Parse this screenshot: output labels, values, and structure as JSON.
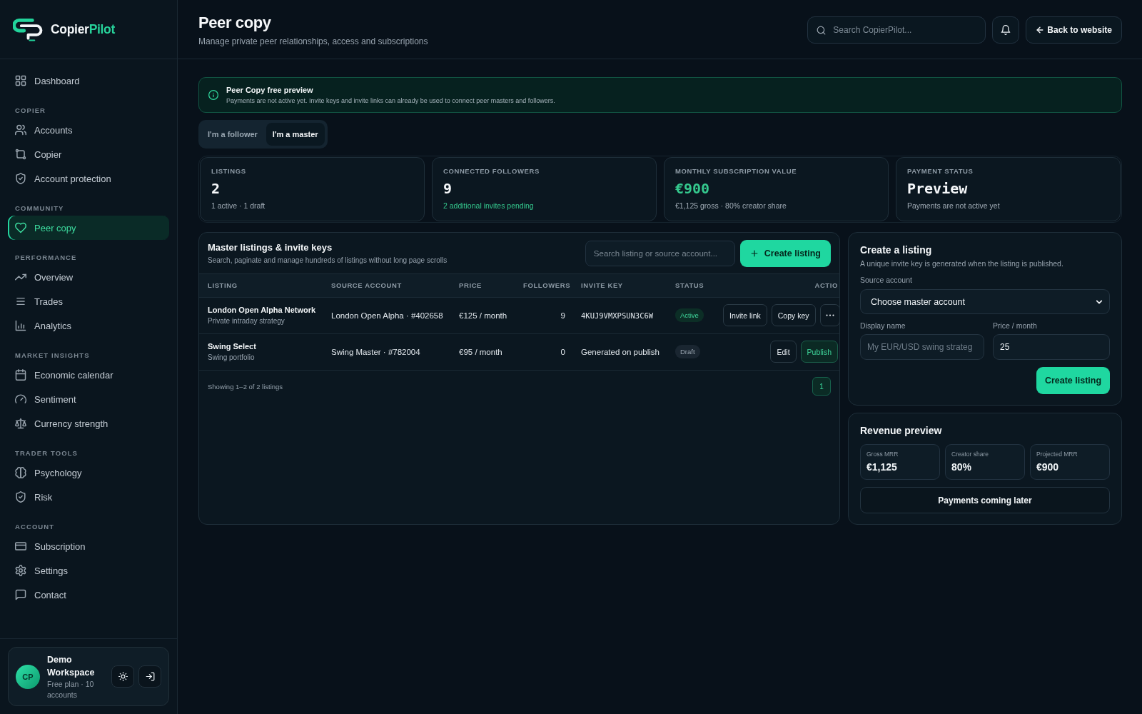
{
  "sidebar": {
    "brand": {
      "name": "Copier",
      "accent": "Pilot"
    },
    "nav": [
      {
        "items": [
          {
            "label": "Dashboard",
            "selected": false
          }
        ]
      },
      {
        "heading": "COPIER",
        "items": [
          {
            "label": "Accounts",
            "selected": false
          },
          {
            "label": "Copier",
            "selected": false
          },
          {
            "label": "Account protection",
            "selected": false
          }
        ]
      },
      {
        "heading": "COMMUNITY",
        "items": [
          {
            "label": "Peer copy",
            "selected": true
          }
        ]
      },
      {
        "heading": "PERFORMANCE",
        "items": [
          {
            "label": "Overview",
            "selected": false
          },
          {
            "label": "Trades",
            "selected": false
          },
          {
            "label": "Analytics",
            "selected": false
          }
        ]
      },
      {
        "heading": "MARKET INSIGHTS",
        "items": [
          {
            "label": "Economic calendar",
            "selected": false
          },
          {
            "label": "Sentiment",
            "selected": false
          },
          {
            "label": "Currency strength",
            "selected": false
          }
        ]
      },
      {
        "heading": "TRADER TOOLS",
        "items": [
          {
            "label": "Psychology",
            "selected": false
          },
          {
            "label": "Risk",
            "selected": false
          }
        ]
      },
      {
        "heading": "ACCOUNT",
        "items": [
          {
            "label": "Subscription",
            "selected": false
          },
          {
            "label": "Settings",
            "selected": false
          },
          {
            "label": "Contact",
            "selected": false
          }
        ]
      }
    ],
    "user": {
      "initials": "CP",
      "name": "Demo Workspace",
      "plan": "Free plan · 10 accounts"
    }
  },
  "header": {
    "title": "Peer copy",
    "subtitle": "Manage private peer relationships, access and subscriptions",
    "search": {
      "placeholder": "Search CopierPilot..."
    },
    "back_button": "Back to website"
  },
  "notice": {
    "title": "Peer Copy free preview",
    "text": "Payments are not active yet. Invite keys and invite links can already be used to connect peer masters and followers."
  },
  "role_tabs": [
    {
      "label": "I'm a follower",
      "selected": false
    },
    {
      "label": "I'm a master",
      "selected": true
    }
  ],
  "stats": [
    {
      "label": "LISTINGS",
      "value": "2",
      "value_accent": false,
      "note": "1 active · 1 draft",
      "note_accent": false
    },
    {
      "label": "CONNECTED FOLLOWERS",
      "value": "9",
      "value_accent": false,
      "note": "2 additional invites pending",
      "note_accent": true
    },
    {
      "label": "MONTHLY SUBSCRIPTION VALUE",
      "value": "€900",
      "value_accent": true,
      "note": "€1,125 gross · 80% creator share",
      "note_accent": false
    },
    {
      "label": "PAYMENT STATUS",
      "value": "Preview",
      "value_accent": false,
      "note": "Payments are not active yet",
      "note_accent": false
    }
  ],
  "listings": {
    "title": "Master listings & invite keys",
    "subtitle": "Search, paginate and manage hundreds of listings without long page scrolls",
    "search": {
      "placeholder": "Search listing or source account..."
    },
    "create_button": "Create listing",
    "columns": [
      "LISTING",
      "SOURCE ACCOUNT",
      "PRICE",
      "FOLLOWERS",
      "INVITE KEY",
      "STATUS",
      "ACTIO"
    ],
    "rows": [
      {
        "listing": {
          "name": "London Open Alpha Network",
          "description": "Private intraday strategy"
        },
        "source_account": "London Open Alpha · #402658",
        "price": "€125 / month",
        "followers": "9",
        "invite_key": {
          "text": "4KUJ9VMXPSUN3C6W",
          "kind": "key"
        },
        "status": {
          "label": "Active",
          "kind": "active"
        },
        "actions": [
          {
            "label": "Invite link",
            "kind": "outline"
          },
          {
            "label": "Copy key",
            "kind": "outline"
          },
          {
            "kind": "more"
          }
        ]
      },
      {
        "listing": {
          "name": "Swing Select",
          "description": "Swing portfolio"
        },
        "source_account": "Swing Master · #782004",
        "price": "€95 / month",
        "followers": "0",
        "invite_key": {
          "text": "Generated on publish",
          "kind": "pending"
        },
        "status": {
          "label": "Draft",
          "kind": "draft"
        },
        "actions": [
          {
            "label": "Edit",
            "kind": "outline"
          },
          {
            "label": "Publish",
            "kind": "accent"
          }
        ]
      }
    ],
    "summary": "Showing 1–2 of 2 listings",
    "pages": [
      {
        "label": "1",
        "selected": true
      }
    ]
  },
  "create_listing": {
    "title": "Create a listing",
    "subtitle": "A unique invite key is generated when the listing is published.",
    "source_account": {
      "label": "Source account",
      "value": "Choose master account"
    },
    "display_name": {
      "label": "Display name",
      "placeholder": "My EUR/USD swing strateg"
    },
    "price": {
      "label": "Price / month",
      "value": "25"
    },
    "submit": "Create listing"
  },
  "revenue_preview": {
    "title": "Revenue preview",
    "metrics": [
      {
        "label": "Gross MRR",
        "value": "€1,125"
      },
      {
        "label": "Creator share",
        "value": "80%"
      },
      {
        "label": "Projected MRR",
        "value": "€900"
      }
    ],
    "button": "Payments coming later"
  }
}
